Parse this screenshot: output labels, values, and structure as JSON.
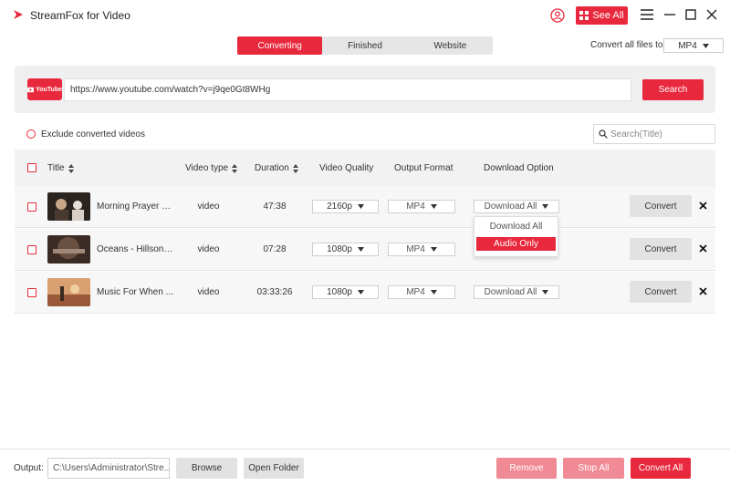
{
  "app": {
    "title": "StreamFox for Video",
    "see_all_label": "See All",
    "accent": "#e8283c"
  },
  "tabs": [
    {
      "label": "Converting",
      "active": true
    },
    {
      "label": "Finished",
      "active": false
    },
    {
      "label": "Website",
      "active": false
    }
  ],
  "convert_all": {
    "label": "Convert all files to:",
    "value": "MP4"
  },
  "url_bar": {
    "site_badge": "YouTube",
    "value": "https://www.youtube.com/watch?v=j9qe0Gt8WHg",
    "search_label": "Search"
  },
  "filter": {
    "exclude_label": "Exclude converted videos",
    "search_placeholder": "Search(Title)"
  },
  "columns": {
    "title": "Title",
    "video_type": "Video type",
    "duration": "Duration",
    "quality": "Video Quality",
    "format": "Output Format",
    "download": "Download Option"
  },
  "rows": [
    {
      "title": "Morning Prayer a...",
      "type": "video",
      "duration": "47:38",
      "quality": "2160p",
      "format": "MP4",
      "download": "Download All",
      "convert_label": "Convert"
    },
    {
      "title": "Oceans - Hillsong...",
      "type": "video",
      "duration": "07:28",
      "quality": "1080p",
      "format": "MP4",
      "download": "",
      "convert_label": "Convert"
    },
    {
      "title": "Music For When ...",
      "type": "video",
      "duration": "03:33:26",
      "quality": "1080p",
      "format": "MP4",
      "download": "Download All",
      "convert_label": "Convert"
    }
  ],
  "dropdown": {
    "items": [
      "Download All",
      "Audio Only"
    ],
    "selected": "Audio Only"
  },
  "footer": {
    "output_label": "Output:",
    "output_path": "C:\\Users\\Administrator\\Stre...",
    "browse_label": "Browse",
    "open_folder_label": "Open Folder",
    "remove_label": "Remove",
    "stop_all_label": "Stop All",
    "convert_all_label": "Convert All"
  }
}
